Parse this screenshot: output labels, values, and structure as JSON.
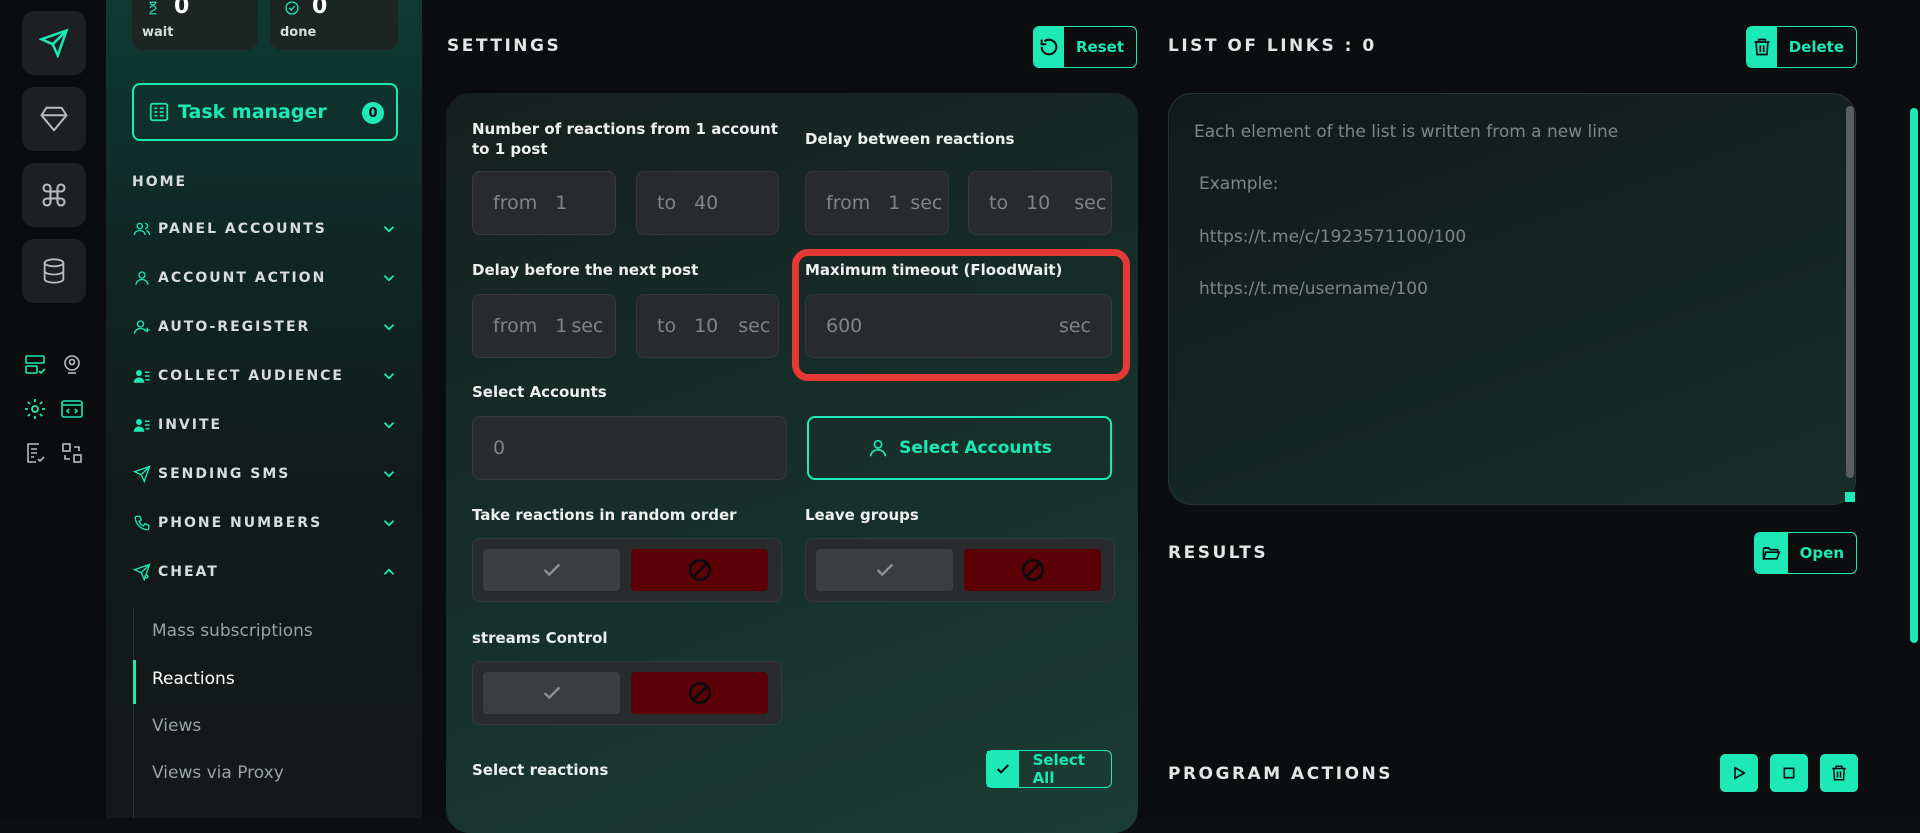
{
  "stats": {
    "wait_count": "0",
    "wait_label": "wait",
    "done_count": "0",
    "done_label": "done"
  },
  "task_manager": {
    "label": "Task manager",
    "count": "0"
  },
  "nav": {
    "home": "HOME",
    "items": [
      {
        "label": "PANEL ACCOUNTS"
      },
      {
        "label": "ACCOUNT ACTION"
      },
      {
        "label": "AUTO-REGISTER"
      },
      {
        "label": "COLLECT AUDIENCE"
      },
      {
        "label": "INVITE"
      },
      {
        "label": "SENDING SMS"
      },
      {
        "label": "PHONE NUMBERS"
      },
      {
        "label": "CHEAT"
      }
    ],
    "cheat_sub": [
      "Mass subscriptions",
      "Reactions",
      "Views",
      "Views via Proxy"
    ]
  },
  "settings": {
    "title": "SETTINGS",
    "reset": "Reset",
    "reactions_label": "Number of reactions from 1 account to 1 post",
    "reactions_from_prefix": "from",
    "reactions_from": "1",
    "reactions_to_prefix": "to",
    "reactions_to": "40",
    "delay_label": "Delay between reactions",
    "delay_from_prefix": "from",
    "delay_from": "1",
    "delay_from_unit": "sec",
    "delay_to_prefix": "to",
    "delay_to": "10",
    "delay_to_unit": "sec",
    "next_post_label": "Delay before the next post",
    "next_from_prefix": "from",
    "next_from": "1",
    "next_from_unit": "sec",
    "next_to_prefix": "to",
    "next_to": "10",
    "next_to_unit": "sec",
    "timeout_label": "Maximum timeout (FloodWait)",
    "timeout_value": "600",
    "timeout_unit": "sec",
    "select_accounts_label": "Select Accounts",
    "select_accounts_value": "0",
    "select_accounts_button": "Select Accounts",
    "random_order_label": "Take reactions in random order",
    "leave_groups_label": "Leave groups",
    "streams_label": "streams Control",
    "select_reactions_label": "Select reactions",
    "select_all": "Select All"
  },
  "links": {
    "title": "LIST OF LINKS : 0",
    "delete": "Delete",
    "placeholder_line1": "Each element of the list is written from a new line",
    "placeholder_example": "Example:",
    "placeholder_url1": "https://t.me/c/1923571100/100",
    "placeholder_url2": "https://t.me/username/100"
  },
  "results": {
    "title": "RESULTS",
    "open": "Open"
  },
  "program_actions": {
    "title": "PROGRAM ACTIONS"
  },
  "colors": {
    "accent": "#1de9b6",
    "danger": "#e53935",
    "deny_bg": "#5c0008"
  }
}
